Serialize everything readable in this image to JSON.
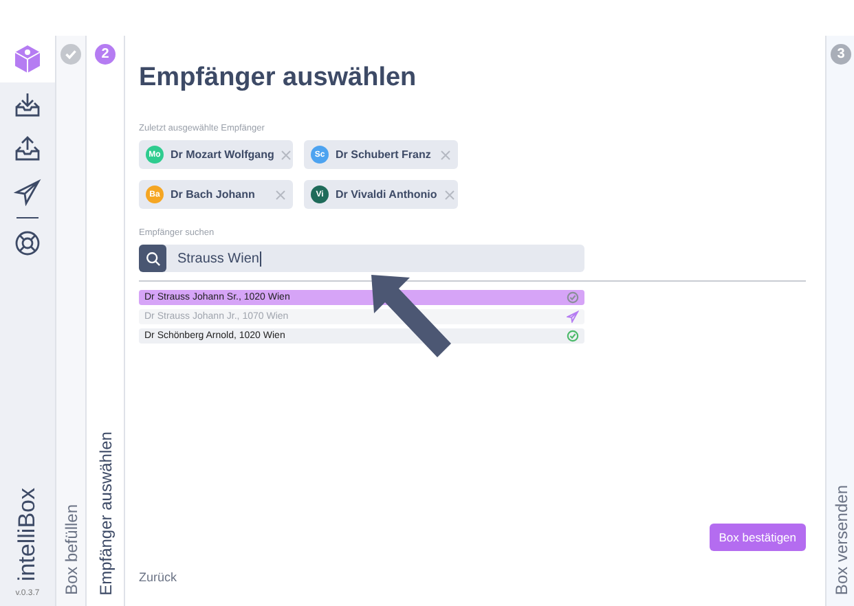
{
  "app": {
    "name": "intelliBox",
    "version": "v.0.3.7"
  },
  "nav": [
    {
      "kind": "logo"
    },
    {
      "kind": "inbox"
    },
    {
      "kind": "outbox"
    },
    {
      "kind": "send"
    },
    {
      "kind": "divider"
    },
    {
      "kind": "help"
    }
  ],
  "steps": [
    {
      "label": "Box befüllen",
      "kind": "done"
    },
    {
      "number": "2",
      "label": "Empfänger auswählen",
      "kind": "active"
    }
  ],
  "title": "Empfänger auswählen",
  "recent": {
    "label": "Zuletzt ausgewählte Empfänger",
    "items": [
      {
        "initials": "Mo",
        "name": "Dr Mozart Wolfgang",
        "color": "#2ecc8f"
      },
      {
        "initials": "Sc",
        "name": "Dr Schubert Franz",
        "color": "#4da3f0"
      },
      {
        "initials": "Ba",
        "name": "Dr Bach Johann",
        "color": "#f5a623"
      },
      {
        "initials": "Vi",
        "name": "Dr Vivaldi Anthonio",
        "color": "#1f6b5a"
      }
    ]
  },
  "search": {
    "label": "Empfänger suchen",
    "value": "Strauss Wien"
  },
  "results": [
    {
      "text": "Dr Strauss Johann Sr., 1020 Wien",
      "selected": true,
      "disabled": false,
      "kind": "done"
    },
    {
      "text": "Dr Strauss Johann Jr., 1070 Wien",
      "selected": false,
      "disabled": true,
      "kind": "sent"
    },
    {
      "text": "Dr Schönberg Arnold, 1020 Wien",
      "selected": false,
      "disabled": false,
      "kind": "ok"
    }
  ],
  "back": "Zurück",
  "confirm": "Box bestätigen",
  "next_step": {
    "number": "3",
    "label": "Box versenden"
  }
}
